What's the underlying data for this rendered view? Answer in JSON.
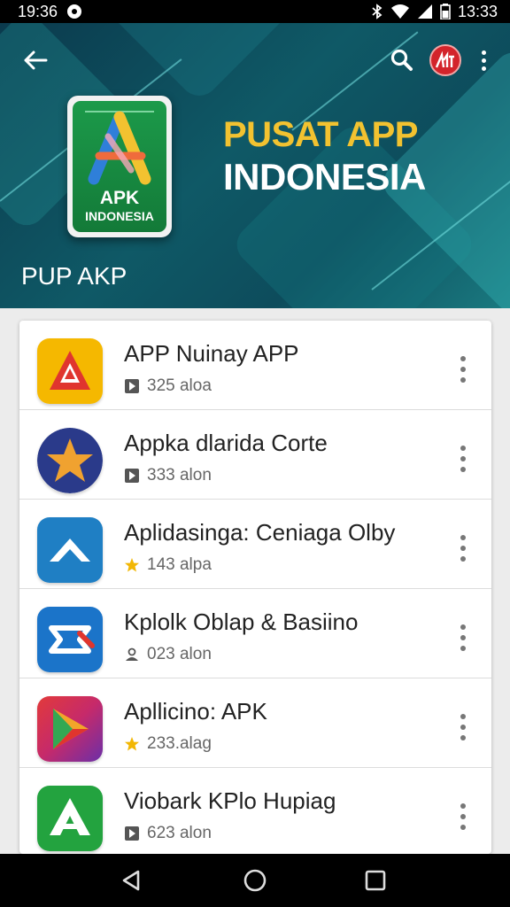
{
  "status_bar": {
    "time_left": "19:36",
    "time_right": "13:33"
  },
  "banner": {
    "title_line1": "PUSAT APP",
    "title_line2": "INDONESIA",
    "subtitle": "PUP AKP",
    "logo_line1": "APK",
    "logo_line2": "INDONESIA"
  },
  "apps": [
    {
      "name": "APP Nuinay APP",
      "meta": "325 aloa",
      "meta_icon": "play-store-icon"
    },
    {
      "name": "Appka dlarida Corte",
      "meta": "333 alon",
      "meta_icon": "play-store-icon"
    },
    {
      "name": "Aplidasinga: Ceniaga Olby",
      "meta": "143 alpa",
      "meta_icon": "star-icon"
    },
    {
      "name": "Kplolk Oblap & Basiino",
      "meta": "023 alon",
      "meta_icon": "user-icon"
    },
    {
      "name": "Apllicino: APK",
      "meta": "233.alag",
      "meta_icon": "star-icon"
    },
    {
      "name": "Viobark KPlo Hupiag",
      "meta": "623 alon",
      "meta_icon": "play-store-icon"
    }
  ],
  "colors": {
    "accent_yellow": "#f2c230",
    "banner_teal": "#0f5966",
    "star": "#f2b705"
  }
}
